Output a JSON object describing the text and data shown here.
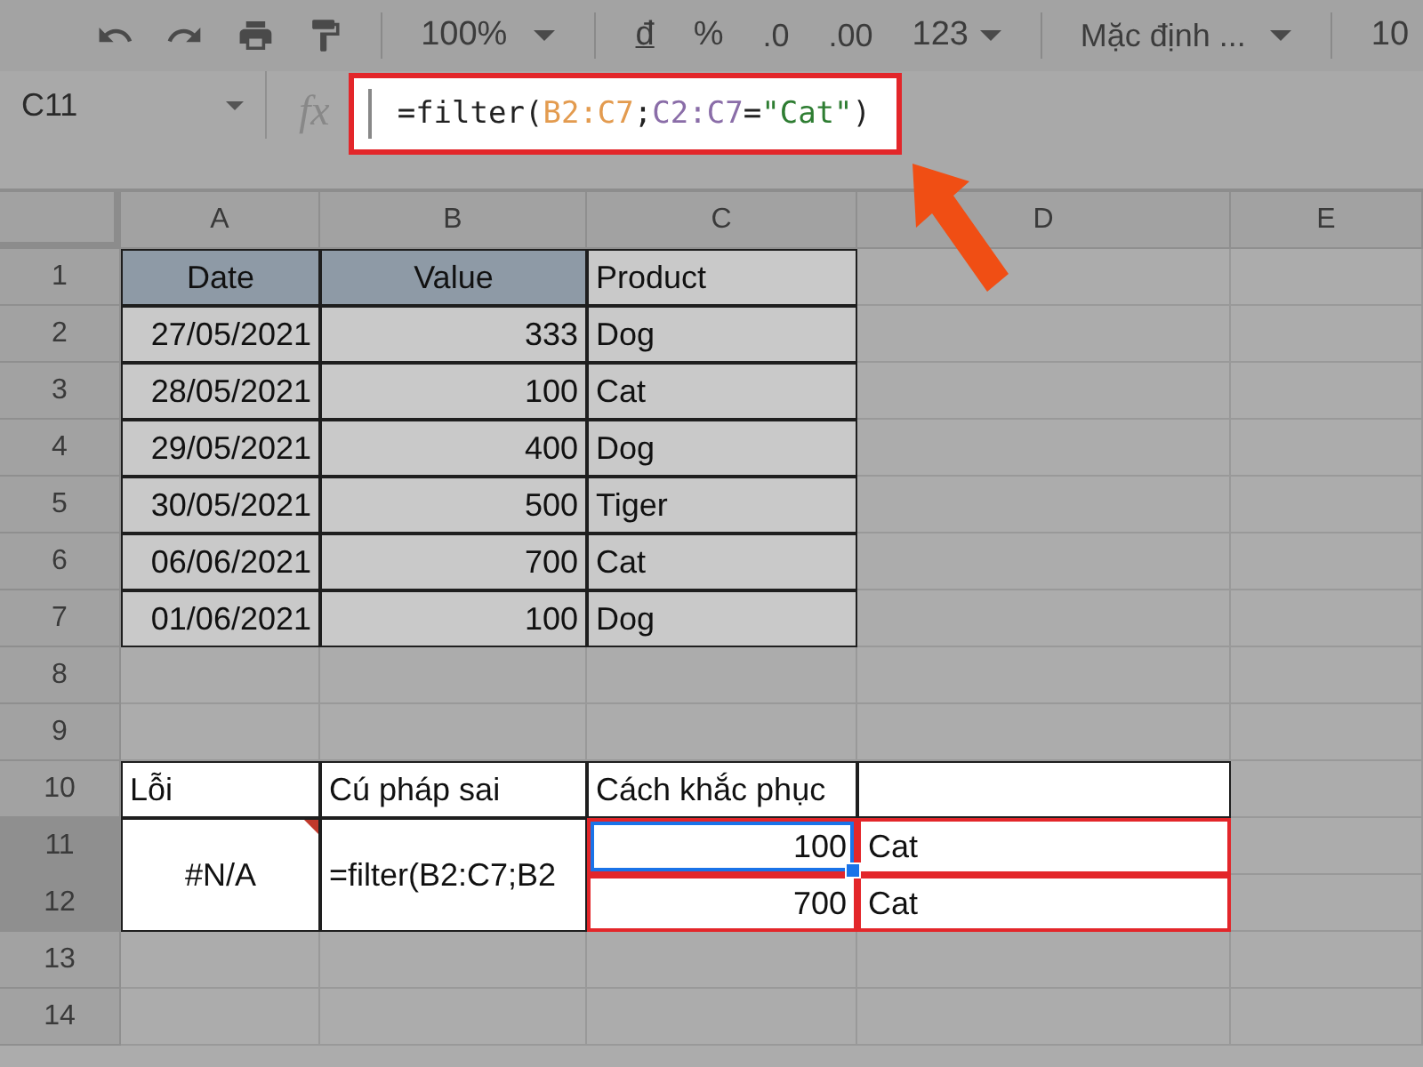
{
  "toolbar": {
    "zoom": "100%",
    "currency": "đ",
    "percent": "%",
    "decrease_decimals": ".0",
    "increase_decimals": ".00",
    "number_format": "123",
    "font": "Mặc định ...",
    "font_size": "10"
  },
  "formula_bar": {
    "cell_ref": "C11",
    "function_label": "fx",
    "highlighted": true,
    "formula": [
      {
        "text": "=filter(",
        "color": "#222222"
      },
      {
        "text": "B2:C7",
        "color": "#e39b4f"
      },
      {
        "text": ";",
        "color": "#222222"
      },
      {
        "text": "C2:C7",
        "color": "#8a6da8"
      },
      {
        "text": "=",
        "color": "#222222"
      },
      {
        "text": "\"Cat\"",
        "color": "#2e7d32"
      },
      {
        "text": ")",
        "color": "#222222"
      }
    ]
  },
  "columns": [
    "A",
    "B",
    "C",
    "D",
    "E"
  ],
  "rows": [
    {
      "number": "1",
      "selected": false,
      "cells": [
        {
          "kind": "header",
          "text": "Date"
        },
        {
          "kind": "header",
          "text": "Value"
        },
        {
          "kind": "text",
          "text": "Product"
        },
        {
          "kind": "empty"
        },
        {
          "kind": "empty"
        }
      ]
    },
    {
      "number": "2",
      "selected": false,
      "cells": [
        {
          "kind": "number",
          "text": "27/05/2021"
        },
        {
          "kind": "number",
          "text": "333"
        },
        {
          "kind": "text",
          "text": "Dog"
        },
        {
          "kind": "empty"
        },
        {
          "kind": "empty"
        }
      ]
    },
    {
      "number": "3",
      "selected": false,
      "cells": [
        {
          "kind": "number",
          "text": "28/05/2021"
        },
        {
          "kind": "number",
          "text": "100"
        },
        {
          "kind": "text",
          "text": "Cat"
        },
        {
          "kind": "empty"
        },
        {
          "kind": "empty"
        }
      ]
    },
    {
      "number": "4",
      "selected": false,
      "cells": [
        {
          "kind": "number",
          "text": "29/05/2021"
        },
        {
          "kind": "number",
          "text": "400"
        },
        {
          "kind": "text",
          "text": "Dog"
        },
        {
          "kind": "empty"
        },
        {
          "kind": "empty"
        }
      ]
    },
    {
      "number": "5",
      "selected": false,
      "cells": [
        {
          "kind": "number",
          "text": "30/05/2021"
        },
        {
          "kind": "number",
          "text": "500"
        },
        {
          "kind": "text",
          "text": "Tiger"
        },
        {
          "kind": "empty"
        },
        {
          "kind": "empty"
        }
      ]
    },
    {
      "number": "6",
      "selected": false,
      "cells": [
        {
          "kind": "number",
          "text": "06/06/2021"
        },
        {
          "kind": "number",
          "text": "700"
        },
        {
          "kind": "text",
          "text": "Cat"
        },
        {
          "kind": "empty"
        },
        {
          "kind": "empty"
        }
      ]
    },
    {
      "number": "7",
      "selected": false,
      "cells": [
        {
          "kind": "number",
          "text": "01/06/2021"
        },
        {
          "kind": "number",
          "text": "100"
        },
        {
          "kind": "text",
          "text": "Dog"
        },
        {
          "kind": "empty"
        },
        {
          "kind": "empty"
        }
      ]
    },
    {
      "number": "8",
      "selected": false,
      "cells": [
        {
          "kind": "empty"
        },
        {
          "kind": "empty"
        },
        {
          "kind": "empty"
        },
        {
          "kind": "empty"
        },
        {
          "kind": "empty"
        }
      ]
    },
    {
      "number": "9",
      "selected": false,
      "cells": [
        {
          "kind": "empty"
        },
        {
          "kind": "empty"
        },
        {
          "kind": "empty"
        },
        {
          "kind": "empty"
        },
        {
          "kind": "empty"
        }
      ]
    },
    {
      "number": "10",
      "selected": false,
      "cells": [
        {
          "kind": "note",
          "text": "Lỗi"
        },
        {
          "kind": "note",
          "text": "Cú pháp sai"
        },
        {
          "kind": "note",
          "text": "Cách khắc phục"
        },
        {
          "kind": "blank"
        },
        {
          "kind": "empty"
        }
      ]
    },
    {
      "number": "11",
      "selected": true,
      "cells": [
        {
          "kind": "error",
          "text": "#N/A",
          "merged_down": true
        },
        {
          "kind": "note",
          "text": "=filter(B2:C7;B2",
          "merged_down": true
        },
        {
          "kind": "figure",
          "text": "100",
          "selected": true,
          "outlined": true
        },
        {
          "kind": "note",
          "text": "Cat",
          "outlined": true
        },
        {
          "kind": "empty"
        }
      ]
    },
    {
      "number": "12",
      "selected": true,
      "cells": [
        {
          "kind": "figure",
          "text": "700",
          "selected": false,
          "outlined": true
        },
        {
          "kind": "note",
          "text": "Cat",
          "outlined": true
        },
        {
          "kind": "empty"
        }
      ]
    },
    {
      "number": "13",
      "selected": false,
      "cells": [
        {
          "kind": "empty"
        },
        {
          "kind": "empty"
        },
        {
          "kind": "empty"
        },
        {
          "kind": "empty"
        },
        {
          "kind": "empty"
        }
      ]
    },
    {
      "number": "14",
      "selected": false,
      "cells": [
        {
          "kind": "empty"
        },
        {
          "kind": "empty"
        },
        {
          "kind": "empty"
        },
        {
          "kind": "empty"
        },
        {
          "kind": "empty"
        }
      ]
    }
  ]
}
